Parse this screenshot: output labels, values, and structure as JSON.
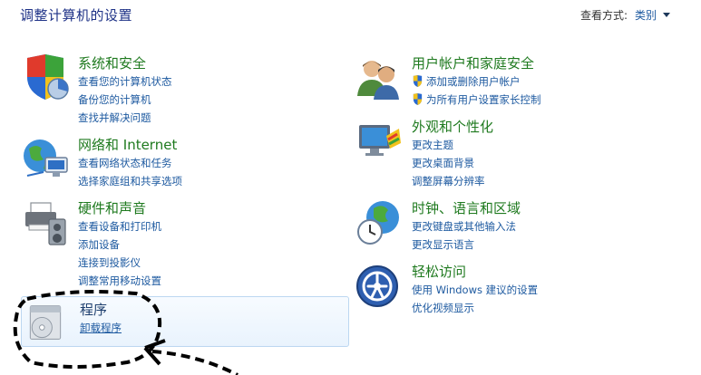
{
  "page_title": "调整计算机的设置",
  "view": {
    "label": "查看方式:",
    "value": "类别"
  },
  "categories": {
    "system_security": {
      "title": "系统和安全",
      "links": [
        "查看您的计算机状态",
        "备份您的计算机",
        "查找并解决问题"
      ]
    },
    "network_internet": {
      "title": "网络和 Internet",
      "links": [
        "查看网络状态和任务",
        "选择家庭组和共享选项"
      ]
    },
    "hardware_sound": {
      "title": "硬件和声音",
      "links": [
        "查看设备和打印机",
        "添加设备",
        "连接到投影仪",
        "调整常用移动设置"
      ]
    },
    "programs": {
      "title": "程序",
      "links": [
        "卸载程序"
      ]
    },
    "user_accounts": {
      "title": "用户帐户和家庭安全",
      "links": [
        "添加或删除用户帐户",
        "为所有用户设置家长控制"
      ]
    },
    "appearance": {
      "title": "外观和个性化",
      "links": [
        "更改主题",
        "更改桌面背景",
        "调整屏幕分辨率"
      ]
    },
    "clock_language": {
      "title": "时钟、语言和区域",
      "links": [
        "更改键盘或其他输入法",
        "更改显示语言"
      ]
    },
    "ease_of_access": {
      "title": "轻松访问",
      "links": [
        "使用 Windows 建议的设置",
        "优化视频显示"
      ]
    }
  },
  "icons": {
    "system_security": "shield-pie-icon",
    "network_internet": "globe-network-icon",
    "hardware_sound": "printer-speaker-icon",
    "programs": "program-disc-icon",
    "user_accounts": "users-icon",
    "appearance": "monitor-palette-icon",
    "clock_language": "globe-clock-icon",
    "ease_of_access": "ease-access-icon",
    "uac": "uac-shield-icon"
  },
  "colors": {
    "title": "#1e3287",
    "category": "#1f7a1f",
    "link": "#1e5aa0",
    "highlight": "#e9f3fd"
  }
}
